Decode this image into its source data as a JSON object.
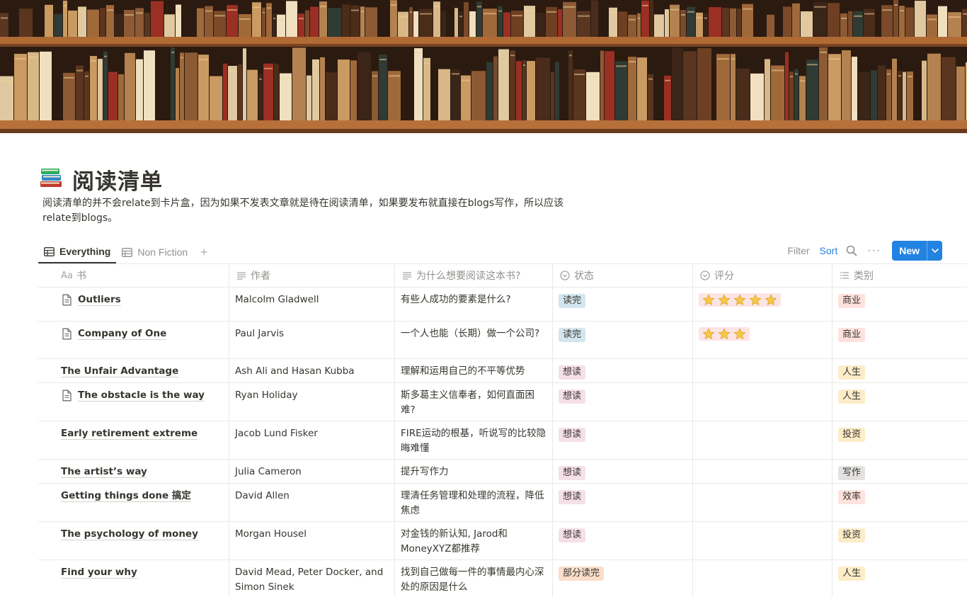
{
  "page": {
    "icon": "books-icon",
    "title": "阅读清单",
    "description": "阅读清单的并不会relate到卡片盒，因为如果不发表文章就是待在阅读清单，如果要发布就直接在blogs写作，所以应该relate到blogs。"
  },
  "views": {
    "tabs": [
      {
        "label": "Everything",
        "active": true
      },
      {
        "label": "Non Fiction",
        "active": false
      }
    ],
    "add_label": "+"
  },
  "toolbar": {
    "filter_label": "Filter",
    "sort_label": "Sort",
    "more_label": "···",
    "new_label": "New"
  },
  "table": {
    "columns": [
      {
        "label": "书",
        "icon": "Aa"
      },
      {
        "label": "作者",
        "icon": "text-icon"
      },
      {
        "label": "为什么想要阅读这本书?",
        "icon": "text-icon"
      },
      {
        "label": "状态",
        "icon": "status-icon"
      },
      {
        "label": "评分",
        "icon": "status-icon"
      },
      {
        "label": "类别",
        "icon": "list-icon"
      }
    ],
    "rows": [
      {
        "title": "Outliers",
        "has_doc": true,
        "author": "Malcolm Gladwell",
        "reason": "有些人成功的要素是什么?",
        "status": "读完",
        "rating": 5,
        "category": "商业"
      },
      {
        "title": "Company of One",
        "has_doc": true,
        "author": "Paul Jarvis",
        "reason": "一个人也能（长期）做一个公司?",
        "status": "读完",
        "rating": 3,
        "category": "商业"
      },
      {
        "title": "The Unfair Advantage",
        "has_doc": false,
        "author": "Ash Ali and Hasan Kubba",
        "reason": "理解和运用自己的不平等优势",
        "status": "想读",
        "rating": 0,
        "category": "人生"
      },
      {
        "title": "The obstacle is the way",
        "has_doc": true,
        "author": "Ryan Holiday",
        "reason": "斯多葛主义信奉者，如何直面困难?",
        "status": "想读",
        "rating": 0,
        "category": "人生"
      },
      {
        "title": "Early retirement extreme",
        "has_doc": false,
        "author": "Jacob Lund Fisker",
        "reason": "FIRE运动的根基，听说写的比较隐晦难懂",
        "status": "想读",
        "rating": 0,
        "category": "投资"
      },
      {
        "title": "The artist’s way",
        "has_doc": false,
        "author": "Julia Cameron",
        "reason": "提升写作力",
        "status": "想读",
        "rating": 0,
        "category": "写作"
      },
      {
        "title": "Getting things done 搞定",
        "has_doc": false,
        "author": "David Allen",
        "reason": "理清任务管理和处理的流程，降低焦虑",
        "status": "想读",
        "rating": 0,
        "category": "效率"
      },
      {
        "title": "The psychology of money",
        "has_doc": false,
        "author": "Morgan Housel",
        "reason": "对金钱的新认知, Jarod和MoneyXYZ都推荐",
        "status": "想读",
        "rating": 0,
        "category": "投资"
      },
      {
        "title": "Find your why",
        "has_doc": false,
        "author": "David Mead, Peter Docker, and Simon Sinek",
        "reason": "找到自己做每一件的事情最内心深处的原因是什么",
        "status": "部分读完",
        "rating": 0,
        "category": "人生"
      }
    ]
  },
  "colors": {
    "status": {
      "读完": "#d3e5ef",
      "想读": "#f5e0e9",
      "部分读完": "#fadec9"
    },
    "category": {
      "商业": "#ffe2dd",
      "人生": "#fdecc8",
      "投资": "#fdecc8",
      "写作": "#e3e2e0",
      "效率": "#ffe2dd"
    },
    "accent": "#2383e2"
  }
}
